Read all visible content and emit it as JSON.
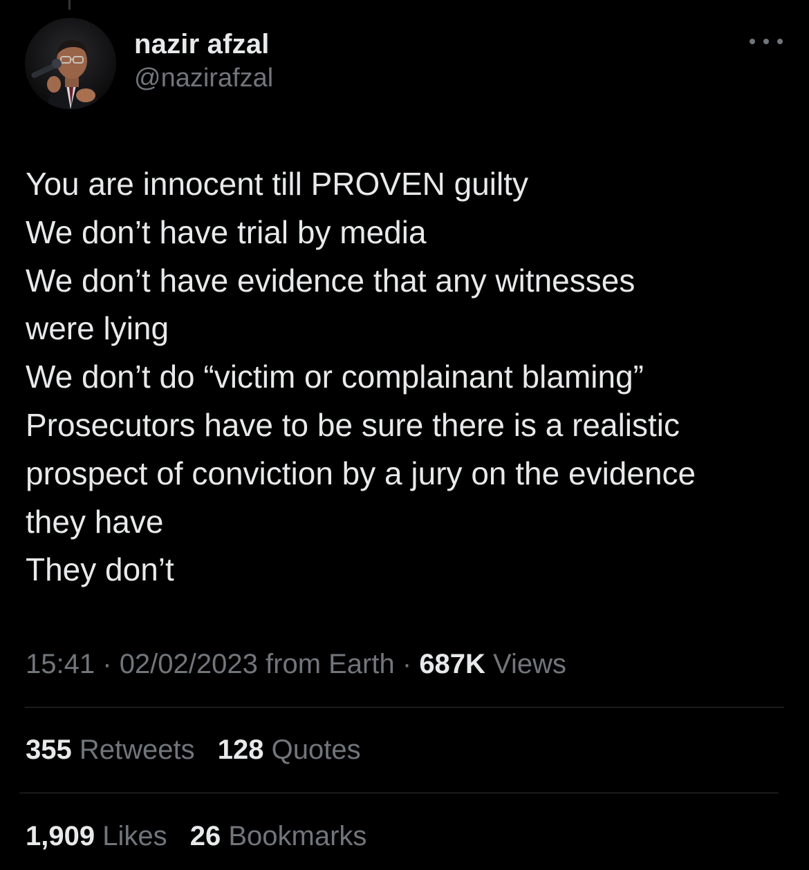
{
  "author": {
    "display_name": "nazir afzal",
    "handle": "@nazirafzal"
  },
  "tweet": {
    "lines": [
      "You are innocent till PROVEN guilty",
      "We don’t have trial by media",
      "We don’t have evidence that any witnesses",
      "were lying",
      "We don’t do “victim or complainant blaming”",
      "Prosecutors have to be sure there is a realistic",
      "prospect of conviction by a jury on the evidence",
      "they have",
      "They don’t"
    ]
  },
  "meta": {
    "time": "15:41",
    "separator": "·",
    "date": "02/02/2023",
    "source": "from Earth",
    "views_count": "687K",
    "views_label": "Views"
  },
  "stats": {
    "retweets_count": "355",
    "retweets_label": "Retweets",
    "quotes_count": "128",
    "quotes_label": "Quotes",
    "likes_count": "1,909",
    "likes_label": "Likes",
    "bookmarks_count": "26",
    "bookmarks_label": "Bookmarks"
  },
  "icons": {
    "more": "more-horizontal-icon"
  },
  "colors": {
    "background": "#000000",
    "primary_text": "#e7e9ea",
    "secondary_text": "#71767b",
    "divider": "#2f3336"
  }
}
